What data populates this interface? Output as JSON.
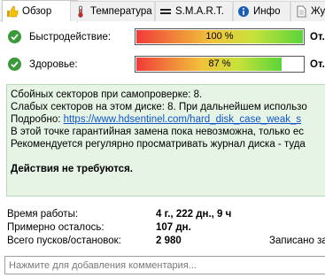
{
  "tabs": [
    {
      "label": "Обзор",
      "icon": "thumbs-up-icon"
    },
    {
      "label": "Температура",
      "icon": "thermometer-icon"
    },
    {
      "label": "S.M.A.R.T.",
      "icon": "smart-bars-icon"
    },
    {
      "label": "Инфо",
      "icon": "info-icon"
    },
    {
      "label": "Жу",
      "icon": "journal-icon"
    }
  ],
  "performance": {
    "label": "Быстродействие:",
    "percent": 100,
    "percent_label": "100 %",
    "action": "От."
  },
  "health": {
    "label": "Здоровье:",
    "percent": 87,
    "percent_label": "87 %",
    "action": "От."
  },
  "info": {
    "line1": "Сбойных секторов при самопроверке: 8.",
    "line2": "Слабых секторов на этом диске: 8. При дальнейшем использо",
    "line3_prefix": "Подробно: ",
    "line3_link": "https://www.hdsentinel.com/hard_disk_case_weak_s",
    "line4": "В этой точке гарантийная замена пока невозможна, только ес",
    "line5": "Рекомендуется регулярно просматривать журнал диска - туда",
    "conclusion": "Действия не требуются."
  },
  "stats": {
    "uptime_label": "Время работы:",
    "uptime_value": "4 г., 222 дн., 9 ч",
    "remaining_label": "Примерно осталось:",
    "remaining_value": "107 дн.",
    "starts_label": "Всего пусков/остановок:",
    "starts_value": "2 980",
    "written_label": "Записано за"
  },
  "comment": {
    "placeholder": "Нажмите для добавления комментария..."
  },
  "colors": {
    "check_green": "#3a9a3a",
    "info_bg": "#e5f4e5",
    "link": "#1155cc"
  }
}
